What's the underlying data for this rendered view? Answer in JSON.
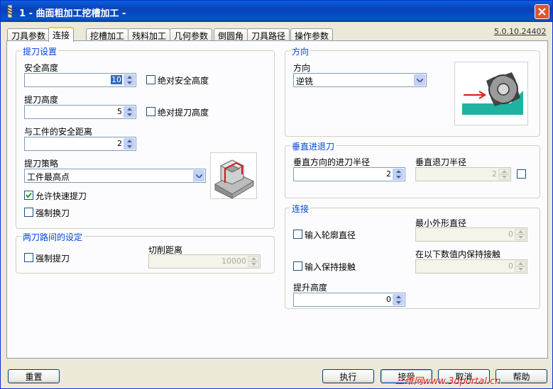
{
  "window": {
    "title": "1 - 曲面粗加工挖槽加工 -",
    "version": "5.0.10.24402"
  },
  "tabs": [
    {
      "label": "刀具参数"
    },
    {
      "label": "连接",
      "active": true
    },
    {
      "label": "挖槽加工"
    },
    {
      "label": "残料加工"
    },
    {
      "label": "几何参数"
    },
    {
      "label": "倒圆角"
    },
    {
      "label": "刀具路径"
    },
    {
      "label": "操作参数"
    }
  ],
  "retract": {
    "legend": "提刀设置",
    "safe_height_label": "安全高度",
    "safe_height_value": "10",
    "abs_safe_height_label": "绝对安全高度",
    "abs_safe_height_checked": false,
    "retract_height_label": "提刀高度",
    "retract_height_value": "5",
    "abs_retract_height_label": "绝对提刀高度",
    "abs_retract_height_checked": false,
    "part_safe_distance_label": "与工件的安全距离",
    "part_safe_distance_value": "2",
    "strategy_label": "提刀策略",
    "strategy_value": "工件最高点",
    "allow_rapid_label": "允许快速提刀",
    "allow_rapid_checked": true,
    "force_toolchange_label": "强制换刀",
    "force_toolchange_checked": false
  },
  "between_paths": {
    "legend": "两刀路间的设定",
    "force_retract_label": "强制提刀",
    "force_retract_checked": false,
    "cut_distance_label": "切削距离",
    "cut_distance_value": "10000"
  },
  "direction": {
    "legend": "方向",
    "label": "方向",
    "value": "逆铣"
  },
  "vertical_lead": {
    "legend": "垂直进退刀",
    "entry_radius_label": "垂直方向的进刀半径",
    "entry_radius_value": "2",
    "exit_radius_label": "垂直退刀半径",
    "exit_radius_value": "2"
  },
  "connect": {
    "legend": "连接",
    "contour_dia_label": "输入轮廓直径",
    "contour_dia_checked": false,
    "min_dia_label": "最小外形直径",
    "min_dia_value": "0",
    "keep_contact_label": "输入保持接触",
    "keep_contact_checked": false,
    "keep_within_label": "在以下数值内保持接触",
    "keep_within_value": "0",
    "lift_height_label": "提升高度",
    "lift_height_value": "0"
  },
  "buttons": {
    "reset": "重置",
    "execute": "执行",
    "ok": "接受",
    "cancel": "取消",
    "help": "帮助"
  },
  "watermark": "三维网www.3dportal.cn",
  "colors": {
    "titlebar": "#0842b8",
    "legend_text": "#0046d5",
    "panel_bg": "#fcfcfe",
    "dialog_bg": "#ece9d8",
    "tool_image_teal": "#20b2a0",
    "arrow_red": "#e02020"
  }
}
